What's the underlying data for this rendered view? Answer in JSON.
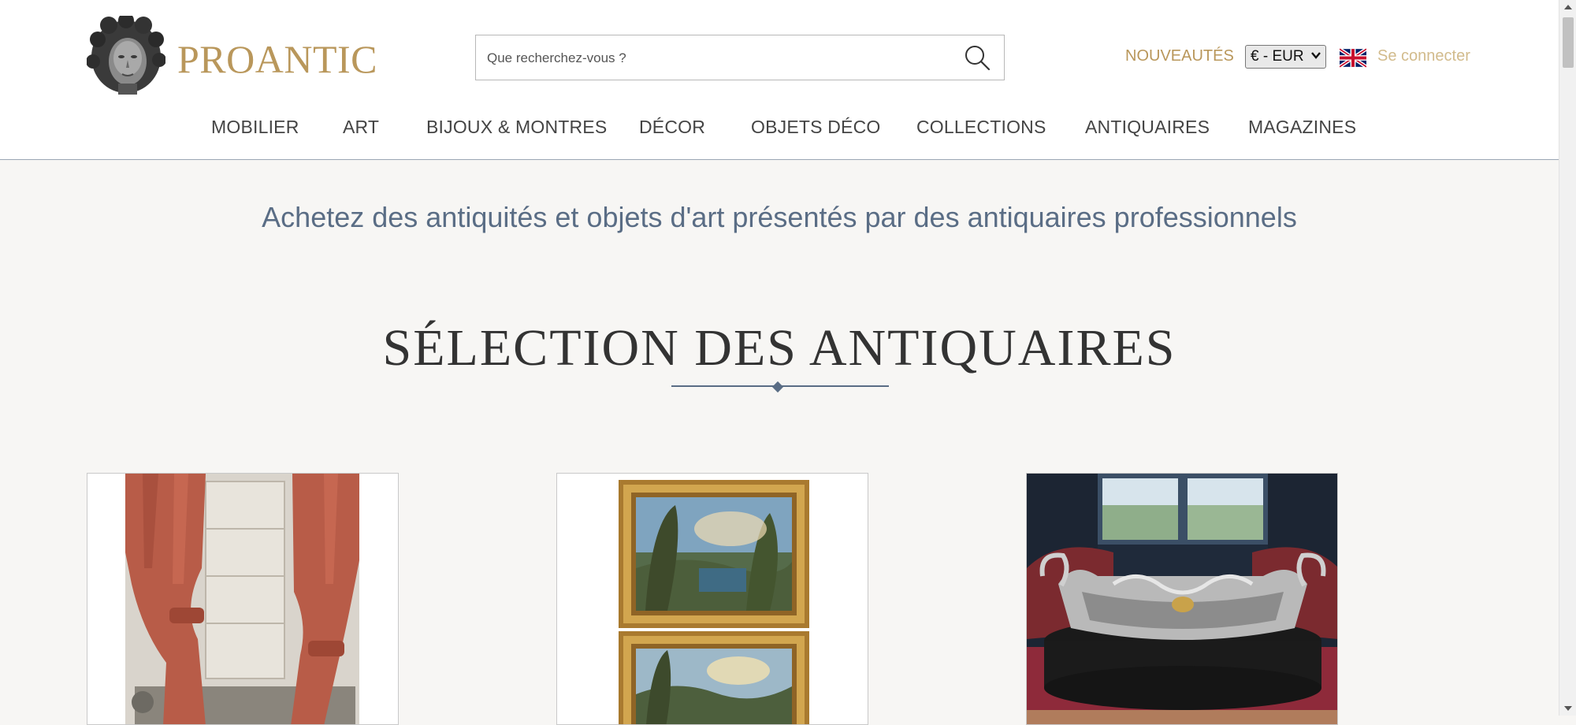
{
  "brand": {
    "name": "PROANTIC",
    "logo_icon": "sculpted-head-logo"
  },
  "search": {
    "placeholder": "Que recherchez-vous ?",
    "value": "",
    "icon": "search-icon"
  },
  "header": {
    "new_label": "NOUVEAUTÉS",
    "currency": {
      "selected": "€ - EUR"
    },
    "language_flag": "uk-flag-icon",
    "login_label": "Se connecter"
  },
  "nav": {
    "items": [
      {
        "label": "MOBILIER"
      },
      {
        "label": "ART"
      },
      {
        "label": "BIJOUX & MONTRES"
      },
      {
        "label": "DÉCOR"
      },
      {
        "label": "OBJETS DÉCO"
      },
      {
        "label": "COLLECTIONS"
      },
      {
        "label": "ANTIQUAIRES"
      },
      {
        "label": "MAGAZINES"
      }
    ]
  },
  "main": {
    "tagline": "Achetez des antiquités et objets d'art présentés par des antiquaires professionnels",
    "section_title": "SÉLECTION DES ANTIQUAIRES",
    "cards": [
      {
        "image": "red-curtains-photo"
      },
      {
        "image": "framed-landscape-paintings-photo"
      },
      {
        "image": "silver-jardiniere-photo"
      }
    ]
  },
  "colors": {
    "gold": "#b9975b",
    "gold_light": "#d2bb8c",
    "slate": "#5a6d85",
    "page_bg": "#f7f6f4"
  }
}
